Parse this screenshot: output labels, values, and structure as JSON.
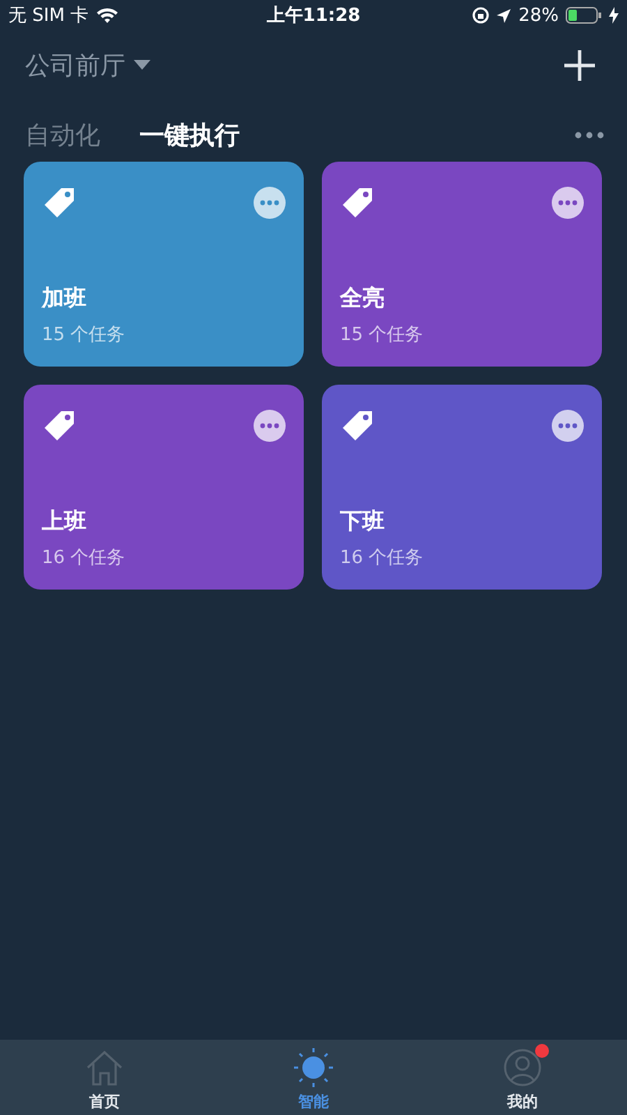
{
  "status_bar": {
    "carrier": "无 SIM 卡",
    "time": "上午11:28",
    "battery": "28%"
  },
  "header": {
    "location": "公司前厅"
  },
  "tabs": [
    {
      "label": "自动化",
      "selected": false
    },
    {
      "label": "一键执行",
      "selected": true
    }
  ],
  "cards": [
    {
      "title": "加班",
      "subtitle": "15 个任务",
      "color": "#3a8fc6"
    },
    {
      "title": "全亮",
      "subtitle": "15 个任务",
      "color": "#7a47c1"
    },
    {
      "title": "上班",
      "subtitle": "16 个任务",
      "color": "#7a47c1"
    },
    {
      "title": "下班",
      "subtitle": "16 个任务",
      "color": "#5f56c7"
    }
  ],
  "bottom_nav": [
    {
      "label": "首页",
      "kind": "home",
      "selected": false,
      "badge": false
    },
    {
      "label": "智能",
      "kind": "smart",
      "selected": true,
      "badge": false
    },
    {
      "label": "我的",
      "kind": "profile",
      "selected": false,
      "badge": true
    }
  ]
}
